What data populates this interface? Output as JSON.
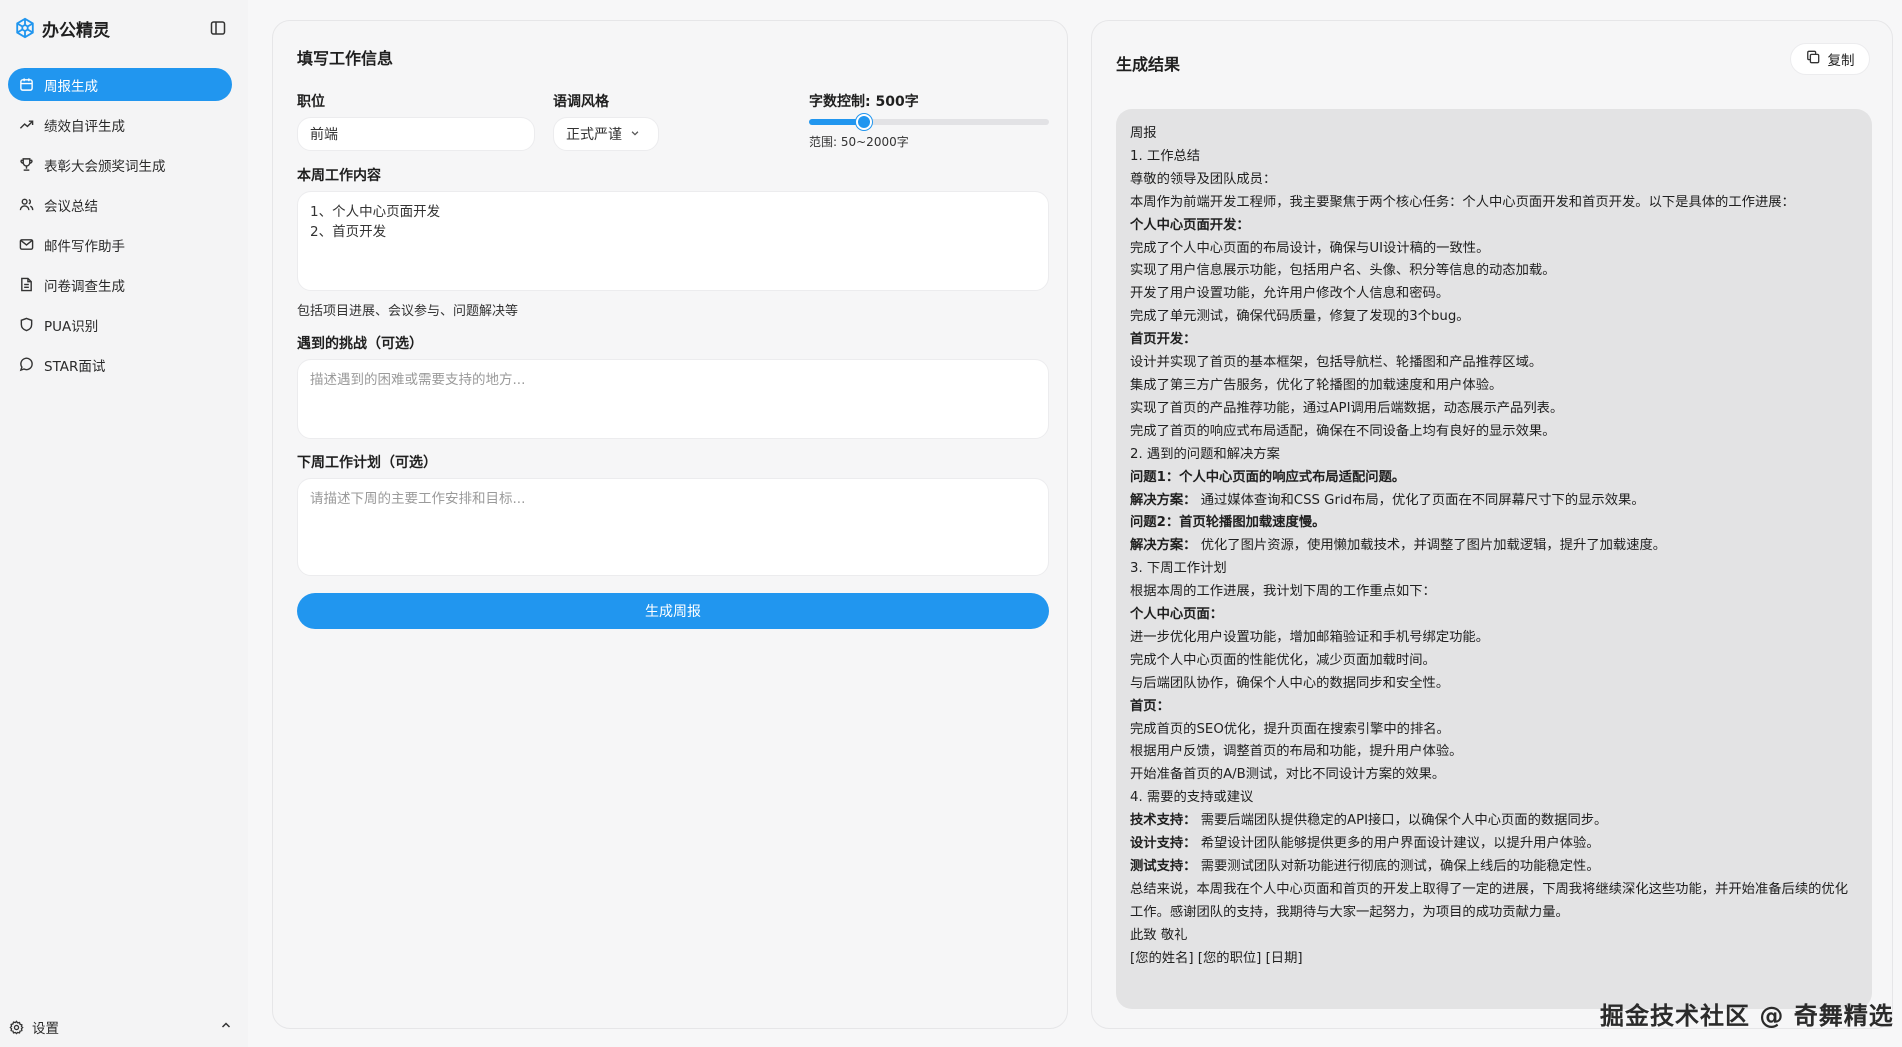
{
  "app": {
    "name": "办公精灵"
  },
  "sidebar": {
    "items": [
      {
        "label": "周报生成",
        "icon": "calendar-icon",
        "active": true
      },
      {
        "label": "绩效自评生成",
        "icon": "trending-up-icon",
        "active": false
      },
      {
        "label": "表彰大会颁奖词生成",
        "icon": "trophy-icon",
        "active": false
      },
      {
        "label": "会议总结",
        "icon": "users-icon",
        "active": false
      },
      {
        "label": "邮件写作助手",
        "icon": "mail-icon",
        "active": false
      },
      {
        "label": "问卷调查生成",
        "icon": "document-icon",
        "active": false
      },
      {
        "label": "PUA识别",
        "icon": "shield-icon",
        "active": false
      },
      {
        "label": "STAR面试",
        "icon": "chat-bubble-icon",
        "active": false
      }
    ],
    "settings_label": "设置"
  },
  "form": {
    "title": "填写工作信息",
    "position_label": "职位",
    "position_value": "前端",
    "tone_label": "语调风格",
    "tone_value": "正式严谨",
    "wordcount_label": "字数控制: 500字",
    "wordcount_value": 500,
    "wordcount_min": 50,
    "wordcount_max": 2000,
    "wordcount_hint": "范围: 50~2000字",
    "content_label": "本周工作内容",
    "content_value": "1、个人中心页面开发\n2、首页开发",
    "content_hint": "包括项目进展、会议参与、问题解决等",
    "challenge_label": "遇到的挑战（可选）",
    "challenge_placeholder": "描述遇到的困难或需要支持的地方...",
    "plan_label": "下周工作计划（可选）",
    "plan_placeholder": "请描述下周的主要工作安排和目标...",
    "submit_label": "生成周报"
  },
  "result": {
    "title": "生成结果",
    "copy_label": "复制",
    "lines": [
      {
        "text": "周报"
      },
      {
        "text": "1. 工作总结"
      },
      {
        "text": "尊敬的领导及团队成员："
      },
      {
        "text": "本周作为前端开发工程师，我主要聚焦于两个核心任务：个人中心页面开发和首页开发。以下是具体的工作进展："
      },
      {
        "bold": "个人中心页面开发："
      },
      {
        "text": "完成了个人中心页面的布局设计，确保与UI设计稿的一致性。"
      },
      {
        "text": "实现了用户信息展示功能，包括用户名、头像、积分等信息的动态加载。"
      },
      {
        "text": "开发了用户设置功能，允许用户修改个人信息和密码。"
      },
      {
        "text": "完成了单元测试，确保代码质量，修复了发现的3个bug。"
      },
      {
        "bold": "首页开发："
      },
      {
        "text": "设计并实现了首页的基本框架，包括导航栏、轮播图和产品推荐区域。"
      },
      {
        "text": "集成了第三方广告服务，优化了轮播图的加载速度和用户体验。"
      },
      {
        "text": "实现了首页的产品推荐功能，通过API调用后端数据，动态展示产品列表。"
      },
      {
        "text": "完成了首页的响应式布局适配，确保在不同设备上均有良好的显示效果。"
      },
      {
        "text": "2. 遇到的问题和解决方案"
      },
      {
        "bold": "问题1：个人中心页面的响应式布局适配问题。"
      },
      {
        "bold": "解决方案：",
        "text": " 通过媒体查询和CSS Grid布局，优化了页面在不同屏幕尺寸下的显示效果。"
      },
      {
        "bold": "问题2：首页轮播图加载速度慢。"
      },
      {
        "bold": "解决方案：",
        "text": " 优化了图片资源，使用懒加载技术，并调整了图片加载逻辑，提升了加载速度。"
      },
      {
        "text": "3. 下周工作计划"
      },
      {
        "text": "根据本周的工作进展，我计划下周的工作重点如下："
      },
      {
        "bold": "个人中心页面："
      },
      {
        "text": "进一步优化用户设置功能，增加邮箱验证和手机号绑定功能。"
      },
      {
        "text": "完成个人中心页面的性能优化，减少页面加载时间。"
      },
      {
        "text": "与后端团队协作，确保个人中心的数据同步和安全性。"
      },
      {
        "bold": "首页："
      },
      {
        "text": "完成首页的SEO优化，提升页面在搜索引擎中的排名。"
      },
      {
        "text": "根据用户反馈，调整首页的布局和功能，提升用户体验。"
      },
      {
        "text": "开始准备首页的A/B测试，对比不同设计方案的效果。"
      },
      {
        "text": "4. 需要的支持或建议"
      },
      {
        "bold": "技术支持：",
        "text": " 需要后端团队提供稳定的API接口，以确保个人中心页面的数据同步。"
      },
      {
        "bold": "设计支持：",
        "text": " 希望设计团队能够提供更多的用户界面设计建议，以提升用户体验。"
      },
      {
        "bold": "测试支持：",
        "text": " 需要测试团队对新功能进行彻底的测试，确保上线后的功能稳定性。"
      },
      {
        "text": "总结来说，本周我在个人中心页面和首页的开发上取得了一定的进展，下周我将继续深化这些功能，并开始准备后续的优化工作。感谢团队的支持，我期待与大家一起努力，为项目的成功贡献力量。",
        "wrap": true
      },
      {
        "text": "此致 敬礼"
      },
      {
        "text": "[您的姓名] [您的职位] [日期]"
      }
    ]
  },
  "watermark": "掘金技术社区 @ 奇舞精选",
  "colors": {
    "accent": "#2196ef",
    "sidebar_bg": "#f4f4f5",
    "result_bg": "#e3e3e4"
  }
}
